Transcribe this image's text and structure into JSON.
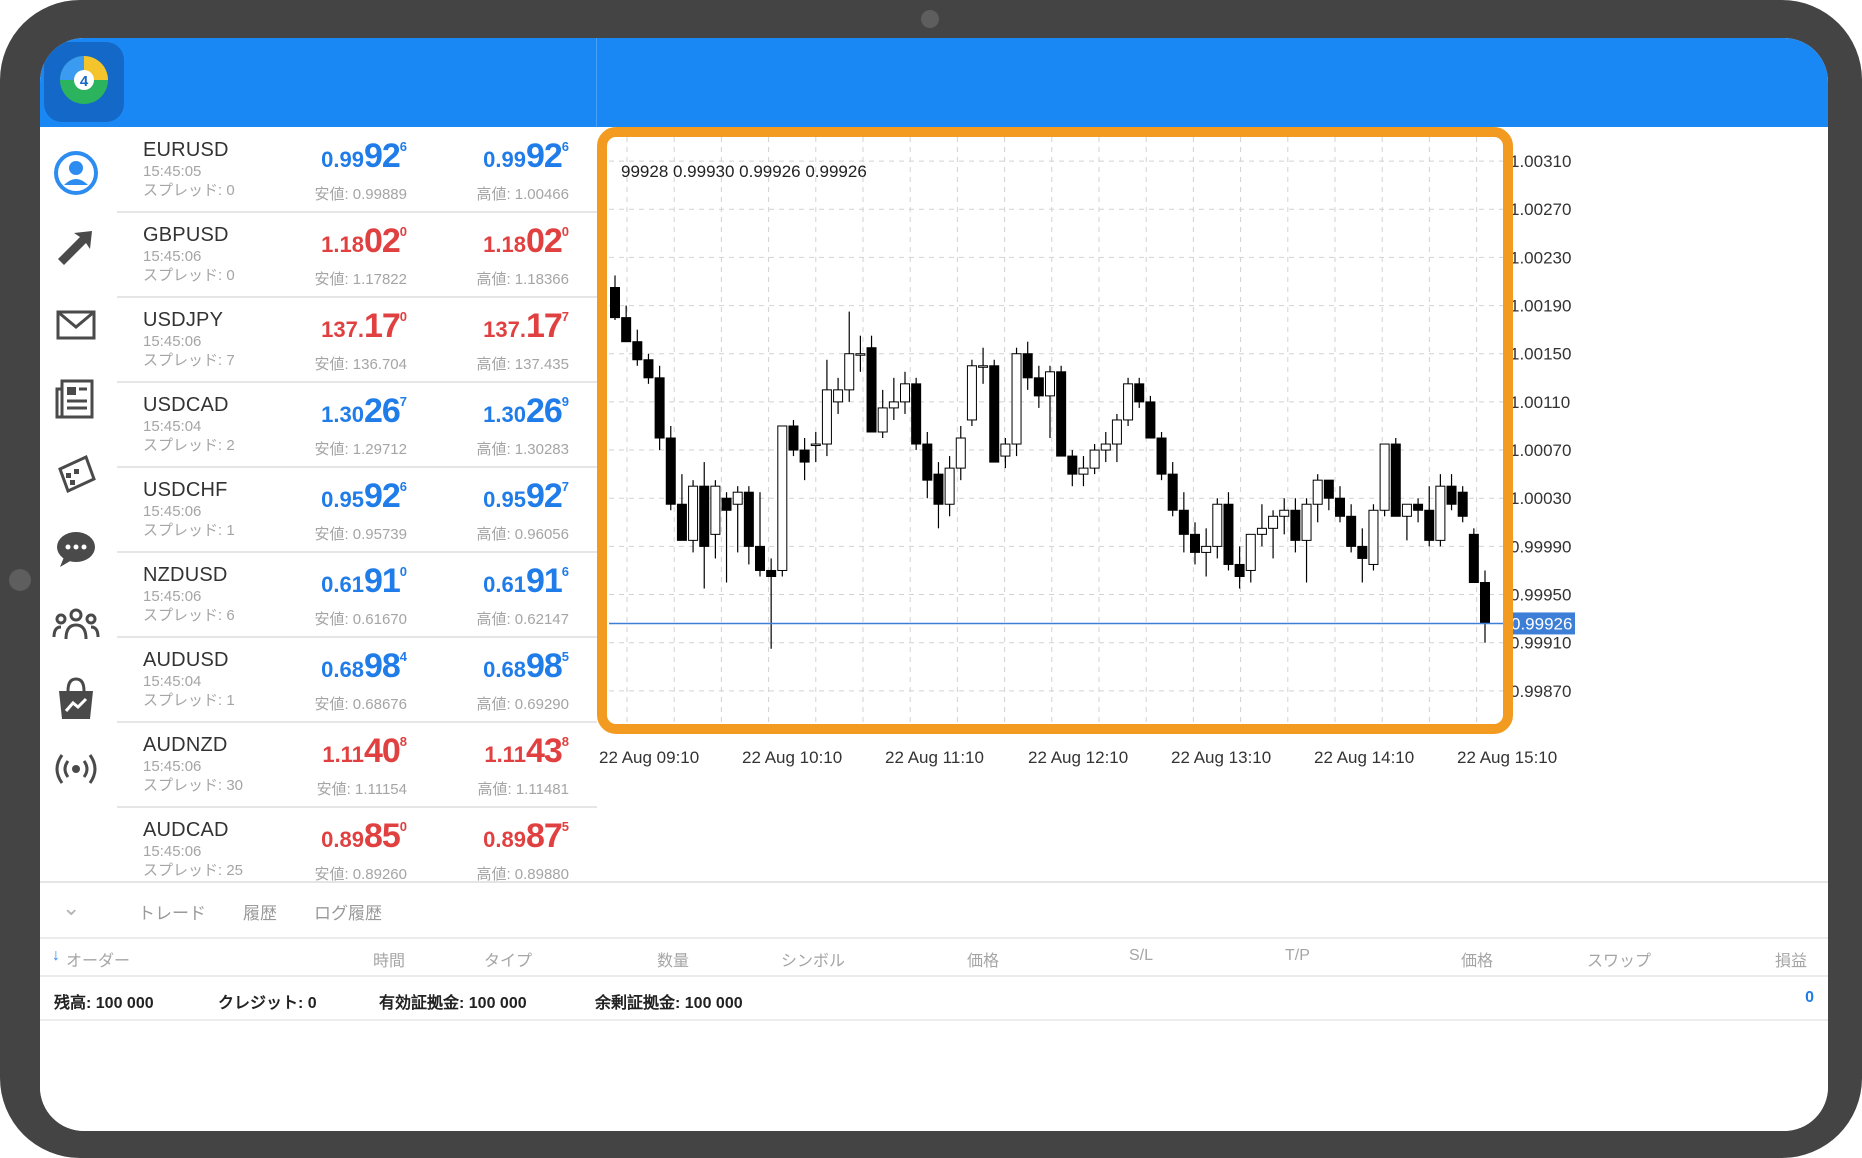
{
  "quotes": [
    {
      "symbol": "EURUSD",
      "time": "15:45:05",
      "spread": "スプレッド: 0",
      "bid": {
        "pre": "0.99",
        "big": "92",
        "sup": "6"
      },
      "ask": {
        "pre": "0.99",
        "big": "92",
        "sup": "6"
      },
      "low": "安値: 0.99889",
      "high": "高値: 1.00466",
      "color": "blue"
    },
    {
      "symbol": "GBPUSD",
      "time": "15:45:06",
      "spread": "スプレッド: 0",
      "bid": {
        "pre": "1.18",
        "big": "02",
        "sup": "0"
      },
      "ask": {
        "pre": "1.18",
        "big": "02",
        "sup": "0"
      },
      "low": "安値: 1.17822",
      "high": "高値: 1.18366",
      "color": "red"
    },
    {
      "symbol": "USDJPY",
      "time": "15:45:06",
      "spread": "スプレッド: 7",
      "bid": {
        "pre": "137.",
        "big": "17",
        "sup": "0"
      },
      "ask": {
        "pre": "137.",
        "big": "17",
        "sup": "7"
      },
      "low": "安値: 136.704",
      "high": "高値: 137.435",
      "color": "red"
    },
    {
      "symbol": "USDCAD",
      "time": "15:45:04",
      "spread": "スプレッド: 2",
      "bid": {
        "pre": "1.30",
        "big": "26",
        "sup": "7"
      },
      "ask": {
        "pre": "1.30",
        "big": "26",
        "sup": "9"
      },
      "low": "安値: 1.29712",
      "high": "高値: 1.30283",
      "color": "blue"
    },
    {
      "symbol": "USDCHF",
      "time": "15:45:06",
      "spread": "スプレッド: 1",
      "bid": {
        "pre": "0.95",
        "big": "92",
        "sup": "6"
      },
      "ask": {
        "pre": "0.95",
        "big": "92",
        "sup": "7"
      },
      "low": "安値: 0.95739",
      "high": "高値: 0.96056",
      "color": "blue"
    },
    {
      "symbol": "NZDUSD",
      "time": "15:45:06",
      "spread": "スプレッド: 6",
      "bid": {
        "pre": "0.61",
        "big": "91",
        "sup": "0"
      },
      "ask": {
        "pre": "0.61",
        "big": "91",
        "sup": "6"
      },
      "low": "安値: 0.61670",
      "high": "高値: 0.62147",
      "color": "blue"
    },
    {
      "symbol": "AUDUSD",
      "time": "15:45:04",
      "spread": "スプレッド: 1",
      "bid": {
        "pre": "0.68",
        "big": "98",
        "sup": "4"
      },
      "ask": {
        "pre": "0.68",
        "big": "98",
        "sup": "5"
      },
      "low": "安値: 0.68676",
      "high": "高値: 0.69290",
      "color": "blue"
    },
    {
      "symbol": "AUDNZD",
      "time": "15:45:06",
      "spread": "スプレッド: 30",
      "bid": {
        "pre": "1.11",
        "big": "40",
        "sup": "8"
      },
      "ask": {
        "pre": "1.11",
        "big": "43",
        "sup": "8"
      },
      "low": "安値: 1.11154",
      "high": "高値: 1.11481",
      "color": "red"
    },
    {
      "symbol": "AUDCAD",
      "time": "15:45:06",
      "spread": "スプレッド: 25",
      "bid": {
        "pre": "0.89",
        "big": "85",
        "sup": "0"
      },
      "ask": {
        "pre": "0.89",
        "big": "87",
        "sup": "5"
      },
      "low": "安値: 0.89260",
      "high": "高値: 0.89880",
      "color": "red"
    }
  ],
  "nav": [
    {
      "name": "quotes-icon"
    },
    {
      "name": "trade-icon"
    },
    {
      "name": "mail-icon"
    },
    {
      "name": "news-icon"
    },
    {
      "name": "calendar-icon"
    },
    {
      "name": "chat-icon"
    },
    {
      "name": "community-icon"
    },
    {
      "name": "market-icon"
    },
    {
      "name": "signal-icon"
    }
  ],
  "chart": {
    "ohlc_readout": "99928 0.99930 0.99926 0.99926",
    "current_price": "0.99926",
    "highlight_color": "#f29b20",
    "price_line_color": "#3d7fd6"
  },
  "chart_data": {
    "type": "candlestick",
    "ylim": [
      0.9984,
      1.0033
    ],
    "y_ticks": [
      {
        "v": 1.0031,
        "label": "1.00310"
      },
      {
        "v": 1.0027,
        "label": "1.00270"
      },
      {
        "v": 1.0023,
        "label": "1.00230"
      },
      {
        "v": 1.0019,
        "label": "1.00190"
      },
      {
        "v": 1.0015,
        "label": "1.00150"
      },
      {
        "v": 1.0011,
        "label": "1.00110"
      },
      {
        "v": 1.0007,
        "label": "1.00070"
      },
      {
        "v": 1.0003,
        "label": "1.00030"
      },
      {
        "v": 0.9999,
        "label": "0.99990"
      },
      {
        "v": 0.9995,
        "label": "0.99950"
      },
      {
        "v": 0.9991,
        "label": "0.99910"
      },
      {
        "v": 0.9987,
        "label": "0.99870"
      }
    ],
    "x_labels": [
      "22 Aug 09:10",
      "22 Aug 10:10",
      "22 Aug 11:10",
      "22 Aug 12:10",
      "22 Aug 13:10",
      "22 Aug 14:10",
      "22 Aug 15:10"
    ],
    "candles": [
      [
        1.00205,
        1.00215,
        1.00178,
        1.0018
      ],
      [
        1.0018,
        1.0019,
        1.0016,
        1.0016
      ],
      [
        1.0016,
        1.0017,
        1.0014,
        1.00145
      ],
      [
        1.00145,
        1.0015,
        1.00125,
        1.0013
      ],
      [
        1.0013,
        1.0014,
        1.0007,
        1.0008
      ],
      [
        1.0008,
        1.0009,
        1.0002,
        1.00025
      ],
      [
        1.00025,
        1.0005,
        0.99995,
        0.99995
      ],
      [
        0.99995,
        1.00045,
        0.99985,
        1.0004
      ],
      [
        1.0004,
        1.0006,
        0.99955,
        0.9999
      ],
      [
        1.0,
        1.00045,
        0.9998,
        1.0004
      ],
      [
        1.0003,
        1.00035,
        0.9996,
        1.0002
      ],
      [
        1.00025,
        1.0004,
        0.99985,
        1.00035
      ],
      [
        1.00035,
        1.0004,
        0.99975,
        0.9999
      ],
      [
        0.9999,
        1.00035,
        0.99965,
        0.9997
      ],
      [
        0.9997,
        0.9998,
        0.99905,
        0.99965
      ],
      [
        0.9997,
        1.00075,
        0.99965,
        1.0009
      ],
      [
        1.0009,
        1.00095,
        1.00065,
        1.0007
      ],
      [
        1.0007,
        1.0008,
        1.00045,
        1.0006
      ],
      [
        1.00075,
        1.00085,
        1.0006,
        1.00075
      ],
      [
        1.00075,
        1.00145,
        1.00065,
        1.0012
      ],
      [
        1.0011,
        1.0013,
        1.001,
        1.0012
      ],
      [
        1.0012,
        1.00185,
        1.0011,
        1.0015
      ],
      [
        1.0015,
        1.00165,
        1.00135,
        1.0015
      ],
      [
        1.00155,
        1.00165,
        1.00085,
        1.00085
      ],
      [
        1.00085,
        1.0012,
        1.0008,
        1.00105
      ],
      [
        1.00105,
        1.0013,
        1.00095,
        1.0011
      ],
      [
        1.0011,
        1.00135,
        1.001,
        1.00125
      ],
      [
        1.00125,
        1.0013,
        1.0007,
        1.00075
      ],
      [
        1.00075,
        1.00085,
        1.0003,
        1.00045
      ],
      [
        1.0005,
        1.0006,
        1.00005,
        1.00025
      ],
      [
        1.00025,
        1.00065,
        1.00015,
        1.00055
      ],
      [
        1.00055,
        1.0009,
        1.00045,
        1.0008
      ],
      [
        1.00095,
        1.00145,
        1.0009,
        1.0014
      ],
      [
        1.0014,
        1.00155,
        1.00125,
        1.0014
      ],
      [
        1.0014,
        1.00145,
        1.0006,
        1.0006
      ],
      [
        1.00065,
        1.0008,
        1.00055,
        1.00075
      ],
      [
        1.00075,
        1.00155,
        1.00065,
        1.0015
      ],
      [
        1.0015,
        1.0016,
        1.0012,
        1.0013
      ],
      [
        1.0013,
        1.0014,
        1.00105,
        1.00115
      ],
      [
        1.00115,
        1.0014,
        1.0008,
        1.00135
      ],
      [
        1.00135,
        1.0014,
        1.00065,
        1.00065
      ],
      [
        1.00065,
        1.0007,
        1.0004,
        1.0005
      ],
      [
        1.0005,
        1.00065,
        1.0004,
        1.00055
      ],
      [
        1.00055,
        1.00075,
        1.0005,
        1.0007
      ],
      [
        1.0007,
        1.00085,
        1.0006,
        1.00075
      ],
      [
        1.00075,
        1.001,
        1.0006,
        1.00095
      ],
      [
        1.00095,
        1.0013,
        1.0009,
        1.00125
      ],
      [
        1.00125,
        1.0013,
        1.00105,
        1.0011
      ],
      [
        1.0011,
        1.00115,
        1.0008,
        1.0008
      ],
      [
        1.0008,
        1.00085,
        1.00045,
        1.0005
      ],
      [
        1.0005,
        1.0006,
        1.00015,
        1.0002
      ],
      [
        1.0002,
        1.00035,
        0.99985,
        1.0
      ],
      [
        1.0,
        1.0001,
        0.99975,
        0.99985
      ],
      [
        0.99985,
        1.00005,
        0.99965,
        0.9999
      ],
      [
        0.9999,
        1.0003,
        0.9998,
        1.00025
      ],
      [
        1.00025,
        1.00035,
        0.9997,
        0.99975
      ],
      [
        0.99975,
        0.9999,
        0.99955,
        0.99965
      ],
      [
        0.9997,
        1.0,
        0.9996,
        1.0
      ],
      [
        1.0,
        1.00025,
        0.9999,
        1.00005
      ],
      [
        1.00005,
        1.0002,
        0.9998,
        1.00015
      ],
      [
        1.00015,
        1.0003,
        1.0,
        1.0002
      ],
      [
        1.0002,
        1.0003,
        0.99985,
        0.99995
      ],
      [
        0.99995,
        1.0003,
        0.9996,
        1.00025
      ],
      [
        1.00025,
        1.0005,
        1.0001,
        1.00045
      ],
      [
        1.00045,
        1.00045,
        1.0002,
        1.0003
      ],
      [
        1.0003,
        1.0004,
        1.0001,
        1.00015
      ],
      [
        1.00015,
        1.00025,
        0.99985,
        0.9999
      ],
      [
        0.9999,
        1.00005,
        0.9996,
        0.9998
      ],
      [
        0.99975,
        1.00025,
        0.9997,
        1.0002
      ],
      [
        1.0002,
        1.0007,
        1.00015,
        1.00075
      ],
      [
        1.00075,
        1.0008,
        1.00015,
        1.00015
      ],
      [
        1.00015,
        1.0002,
        0.99995,
        1.00025
      ],
      [
        1.00025,
        1.0003,
        1.0001,
        1.0002
      ],
      [
        1.0002,
        1.0004,
        0.9999,
        0.99995
      ],
      [
        0.99995,
        1.0005,
        0.9999,
        1.0004
      ],
      [
        1.0004,
        1.0005,
        1.0002,
        1.00025
      ],
      [
        1.00035,
        1.0004,
        1.0001,
        1.00015
      ],
      [
        1.0,
        1.00005,
        0.9996,
        0.9996
      ],
      [
        0.9996,
        0.9997,
        0.9991,
        0.99926
      ]
    ]
  },
  "bottom": {
    "tabs": [
      "トレード",
      "履歴",
      "ログ履歴"
    ],
    "columns": [
      "オーダー",
      "時間",
      "タイプ",
      "数量",
      "シンボル",
      "価格",
      "S/L",
      "T/P",
      "価格",
      "スワップ",
      "損益"
    ],
    "summary": {
      "balance": "残高:  100 000",
      "credit": "クレジット:  0",
      "equity": "有効証拠金:  100 000",
      "free_margin": "余剰証拠金:  100 000",
      "profit": "0"
    }
  }
}
